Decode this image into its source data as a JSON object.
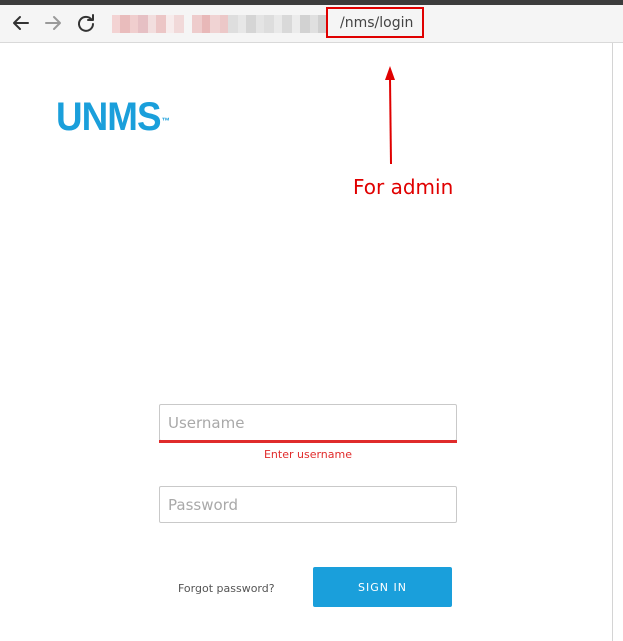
{
  "browser": {
    "url_path": "/nms/login",
    "back_icon": "arrow-left-icon",
    "forward_icon": "arrow-right-icon",
    "reload_icon": "reload-icon"
  },
  "annotation": {
    "label": "For admin",
    "color": "#e00000"
  },
  "brand": {
    "logo_text": "UNMS",
    "trademark": "™",
    "color": "#1a9fdb"
  },
  "login": {
    "username_placeholder": "Username",
    "username_value": "",
    "username_error": "Enter username",
    "password_placeholder": "Password",
    "password_value": "",
    "forgot_label": "Forgot password?",
    "signin_label": "SIGN IN",
    "error_color": "#e02b2b"
  }
}
